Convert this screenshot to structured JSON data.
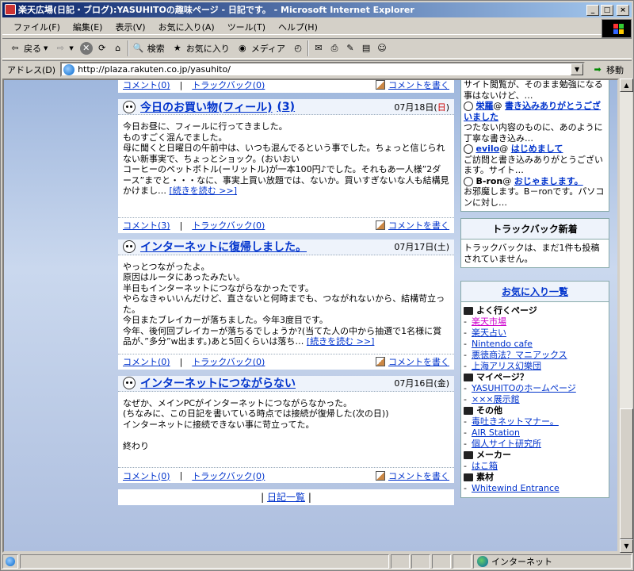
{
  "window": {
    "title": "楽天広場(日記・ブログ):YASUHITOの趣味ページ - 日記です。 - Microsoft Internet Explorer"
  },
  "menu": [
    "ファイル(F)",
    "編集(E)",
    "表示(V)",
    "お気に入り(A)",
    "ツール(T)",
    "ヘルプ(H)"
  ],
  "toolbar": {
    "back": "戻る",
    "search": "検索",
    "favorites": "お気に入り",
    "media": "メディア"
  },
  "address": {
    "label": "アドレス(D)",
    "url": "http://plaza.rakuten.co.jp/yasuhito/",
    "go": "移動"
  },
  "top_footer": {
    "comment": "コメント(0)",
    "sep": "|",
    "trackback": "トラックバック(0)",
    "write": "コメントを書く"
  },
  "entries": [
    {
      "title": "今日のお買い物(フィール)",
      "count": "(3)",
      "date": "07月18日(日)",
      "body": "今日お昼に、フィールに行ってきました。\nものすごく混んでました。\n母に聞くと日曜日の午前中は、いつも混んでるという事でした。ちょっと信じられない新事実で、ちょっとショック。(おいおい\nコーヒーのペットボトル(ーリットル)が一本100円♪でした。それもあ一人様”2ダース”までと・・・なに、事実上買い放題では、ないか。買いすぎないな人も結構見かけまし…",
      "more": "[続きを読む >>]",
      "comment": "コメント(3)",
      "trackback": "トラックバック(0)",
      "write": "コメントを書く"
    },
    {
      "title": "インターネットに復帰しました。",
      "count": "",
      "date": "07月17日(土)",
      "body": "やっとつながったよ。\n原因はルータにあったみたい。\n半日もインターネットにつながらなかったです。\nやらなきゃいいんだけど、直さないと何時までも、つながれないから、結構苛立った。\n今日またブレイカーが落ちました。今年3度目です。\n今年、後何回ブレイカーが落ちるでしょうか?(当てた人の中から抽選で1名様に賞品が、”多分”w出ます。)あと5回くらいは落ち…",
      "more": "[続きを読む >>]",
      "comment": "コメント(0)",
      "trackback": "トラックバック(0)",
      "write": "コメントを書く"
    },
    {
      "title": "インターネットにつながらない",
      "count": "",
      "date": "07月16日(金)",
      "body": "なぜか、メインPCがインターネットにつながらなかった。\n(ちなみに、この日記を書いている時点では接続が復帰した(次の日))\nインターネットに接続できない事に苛立ってた。\n\n終わり",
      "more": "",
      "comment": "コメント(0)",
      "trackback": "トラックバック(0)",
      "write": "コメントを書く"
    }
  ],
  "diary_nav": {
    "label": "日記一覧"
  },
  "comments": {
    "first_lines": "サイト閲覧が、そのまま勉強になる事はないけど、…",
    "items": [
      {
        "who": "栄羅",
        "at": "@",
        "subject": "書き込みありがとうございました",
        "text": "つたない内容のものに、あのように丁寧な書き込み…"
      },
      {
        "who": "evilo",
        "at": "@",
        "subject": "はじめまして",
        "text": "ご訪問と書き込みありがとうございます。サイト…"
      },
      {
        "who": "B-ron",
        "at": "@",
        "subject": "おじゃまします。",
        "text": "お邪魔します。B－ronです。パソコンに対し…"
      }
    ]
  },
  "trackback_box": {
    "title": "トラックバック新着",
    "text": "トラックバックは、まだ1件も投稿されていません。"
  },
  "favorites": {
    "title": "お気に入り一覧",
    "groups": [
      {
        "name": "よく行くページ",
        "links": [
          "楽天市場",
          "楽天占い",
          "Nintendo cafe",
          "悪徳商法？マニアックス",
          "上海アリス幻樂団"
        ]
      },
      {
        "name": "マイページ？",
        "links": [
          "YASUHITOのホームページ",
          "×××展示館"
        ]
      },
      {
        "name": "その他",
        "links": [
          "毒吐きネットマナー。",
          "AIR Station",
          "個人サイト研究所"
        ]
      },
      {
        "name": "メーカー",
        "links": [
          "はこ箱"
        ]
      },
      {
        "name": "素材",
        "links": [
          "Whitewind Entrance"
        ]
      }
    ]
  },
  "status": {
    "zone": "インターネット"
  }
}
